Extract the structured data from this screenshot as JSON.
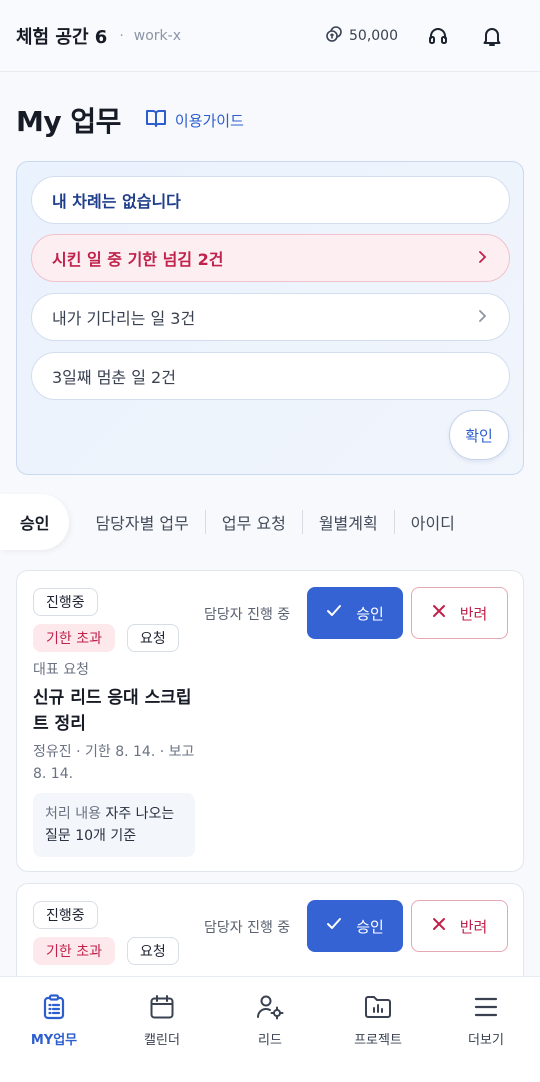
{
  "header": {
    "workspace_title": "체험 공간 6",
    "separator": "·",
    "workspace_slug": "work-x",
    "credits": "50,000",
    "icons": [
      "coins-icon",
      "headset-icon",
      "bell-icon"
    ]
  },
  "page": {
    "title": "My 업무",
    "guide_label": "이용가이드"
  },
  "summary": {
    "items": [
      {
        "label": "내 차례는 없습니다"
      },
      {
        "label": "시킨 일 중 기한 넘김 2건"
      },
      {
        "label": "내가 기다리는 일 3건"
      },
      {
        "label": "3일째 멈춘 일 2건"
      }
    ],
    "confirm_label": "확인"
  },
  "tabs": [
    {
      "label": "승인"
    },
    {
      "label": "담당자별 업무"
    },
    {
      "label": "업무 요청"
    },
    {
      "label": "월별계획"
    },
    {
      "label": "아이디"
    }
  ],
  "cards": [
    {
      "status": "진행중",
      "overdue": "기한 초과",
      "type": "요청",
      "owner_note": "담당자 진행 중",
      "approve": "승인",
      "reject": "반려",
      "meta_label": "대표 요청",
      "title": "신규 리드 응대 스크립트 정리",
      "meta": "정유진 · 기한 8. 14. · 보고 8. 14.",
      "box_label": "처리 내용",
      "box_text": "자주 나오는 질문 10개 기준"
    },
    {
      "status": "진행중",
      "overdue": "기한 초과",
      "type": "요청",
      "owner_note": "담당자 진행 중",
      "approve": "승인",
      "reject": "반려"
    }
  ],
  "bottom_nav": [
    {
      "label": "MY업무",
      "icon": "clipboard-icon",
      "active": true
    },
    {
      "label": "캘린더",
      "icon": "calendar-icon"
    },
    {
      "label": "리드",
      "icon": "user-gear-icon"
    },
    {
      "label": "프로젝트",
      "icon": "folder-chart-icon"
    },
    {
      "label": "더보기",
      "icon": "menu-icon"
    }
  ],
  "colors": {
    "accent": "#3563d4",
    "danger": "#c0224b",
    "danger_bg": "#fde8ec"
  }
}
